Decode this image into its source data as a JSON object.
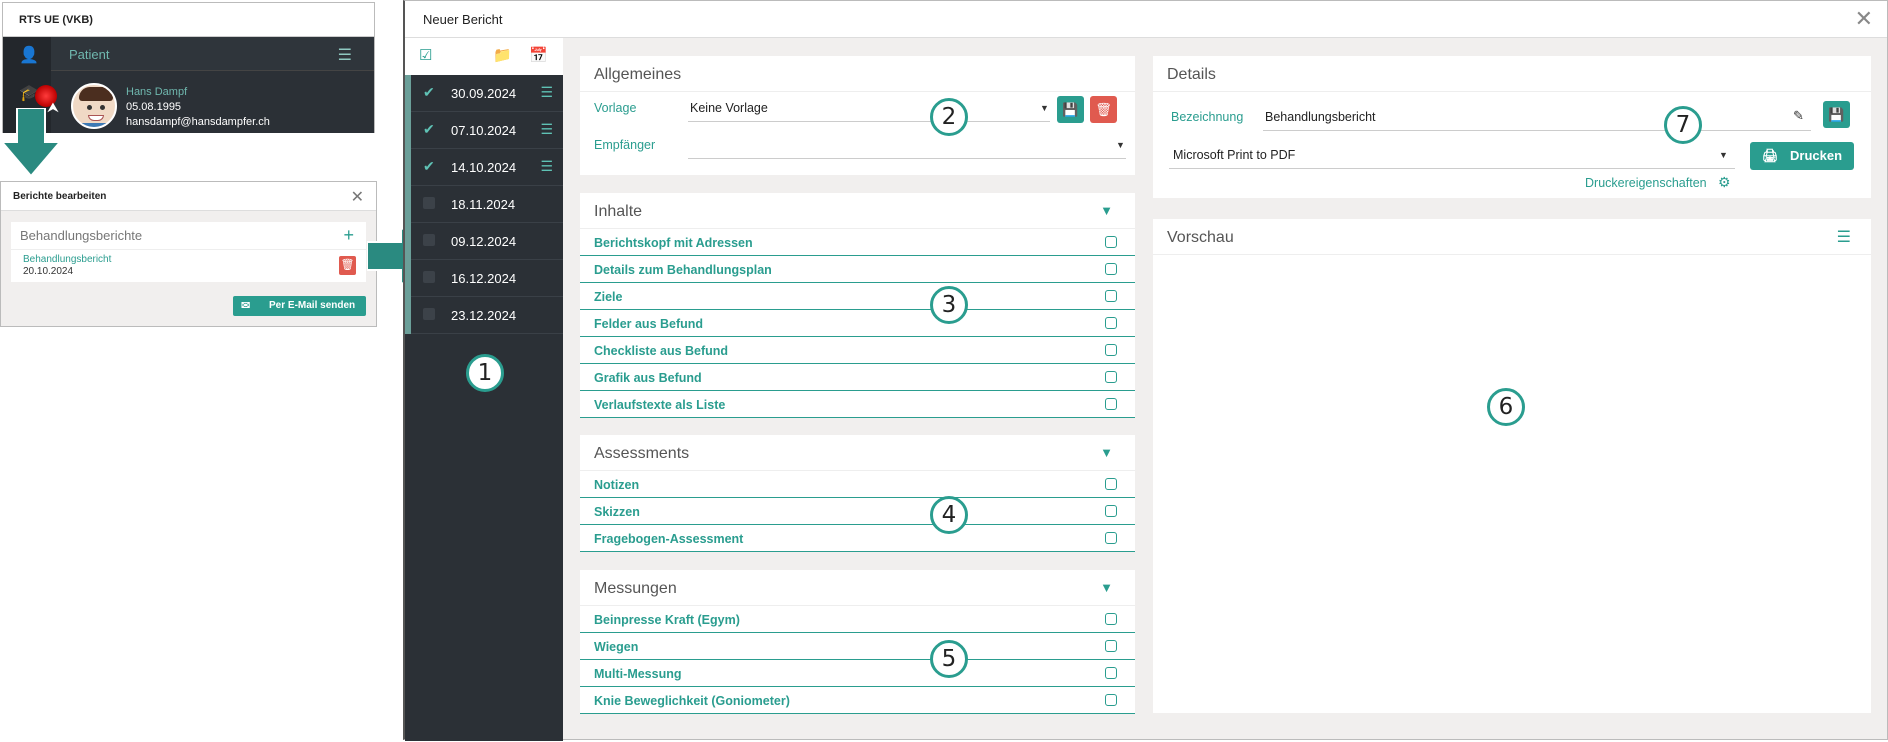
{
  "patient_window": {
    "title": "RTS UE (VKB)",
    "nav_label": "Patient",
    "name": "Hans Dampf",
    "birthdate": "05.08.1995",
    "email": "hansdampf@hansdampfer.ch"
  },
  "edit_window": {
    "title": "Berichte bearbeiten",
    "section": "Behandlungsberichte",
    "report_title": "Behandlungsbericht",
    "report_date": "20.10.2024",
    "email_button": "Per E-Mail senden"
  },
  "dialog": {
    "title": "Neuer Bericht",
    "dates": [
      {
        "date": "30.09.2024",
        "checked": true
      },
      {
        "date": "07.10.2024",
        "checked": true
      },
      {
        "date": "14.10.2024",
        "checked": true
      },
      {
        "date": "18.11.2024",
        "checked": false
      },
      {
        "date": "09.12.2024",
        "checked": false
      },
      {
        "date": "16.12.2024",
        "checked": false
      },
      {
        "date": "23.12.2024",
        "checked": false
      }
    ],
    "allgemeines": {
      "title": "Allgemeines",
      "vorlage_label": "Vorlage",
      "vorlage_value": "Keine Vorlage",
      "empfaenger_label": "Empfänger",
      "empfaenger_value": ""
    },
    "inhalte": {
      "title": "Inhalte",
      "items": [
        "Berichtskopf mit Adressen",
        "Details zum Behandlungsplan",
        "Ziele",
        "Felder aus Befund",
        "Checkliste aus Befund",
        "Grafik aus Befund",
        "Verlaufstexte als Liste"
      ]
    },
    "assessments": {
      "title": "Assessments",
      "items": [
        "Notizen",
        "Skizzen",
        "Fragebogen-Assessment"
      ]
    },
    "messungen": {
      "title": "Messungen",
      "items": [
        "Beinpresse Kraft (Egym)",
        "Wiegen",
        "Multi-Messung",
        "Knie Beweglichkeit (Goniometer)"
      ]
    },
    "details": {
      "title": "Details",
      "bezeichnung_label": "Bezeichnung",
      "bezeichnung_value": "Behandlungsbericht",
      "printer": "Microsoft Print to PDF",
      "print_button": "Drucken",
      "printer_props": "Druckereigenschaften"
    },
    "vorschau": {
      "title": "Vorschau"
    }
  },
  "callouts": [
    "1",
    "2",
    "3",
    "4",
    "5",
    "6",
    "7"
  ],
  "colors": {
    "accent": "#2a9d8f",
    "dark": "#2b3036",
    "danger": "#e05a4f"
  }
}
